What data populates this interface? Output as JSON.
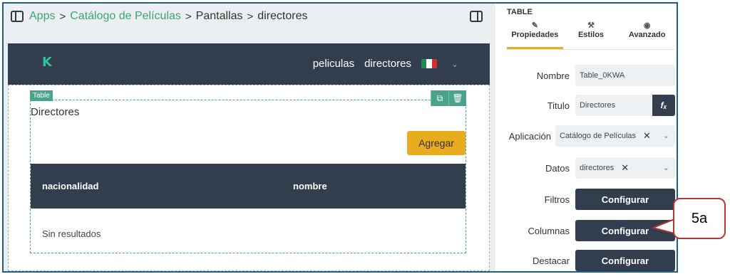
{
  "breadcrumb": {
    "items": [
      "Apps",
      "Catálogo de Películas",
      "Pantallas",
      "directores"
    ]
  },
  "navbar": {
    "logo": "K",
    "links": [
      "peliculas",
      "directores"
    ]
  },
  "table_component": {
    "tag": "Table",
    "title": "Directores",
    "add_label": "Agregar",
    "columns": [
      "nacionalidad",
      "nombre"
    ],
    "empty_text": "Sin resultados"
  },
  "panel": {
    "title": "TABLE",
    "tabs": [
      "Propiedades",
      "Estilos",
      "Avanzado"
    ],
    "fields": {
      "nombre_label": "Nombre",
      "nombre_value": "Table_0KWA",
      "titulo_label": "Titulo",
      "titulo_value": "Directores",
      "aplicacion_label": "Aplicación",
      "aplicacion_value": "Catálogo de Películas",
      "datos_label": "Datos",
      "datos_value": "directores",
      "filtros_label": "Filtros",
      "columnas_label": "Columnas",
      "destacar_label": "Destacar",
      "configurar_label": "Configurar"
    }
  },
  "callout": {
    "text": "5a"
  },
  "colors": {
    "accent_green": "#3aa47a",
    "dark": "#323e4d",
    "yellow": "#e8ac1e",
    "callout_border": "#b33333"
  },
  "icons": [
    "sidebar-toggle-icon",
    "panel-toggle-icon",
    "copy-icon",
    "trash-icon",
    "pencil-icon",
    "paint-bucket-icon",
    "eye-icon",
    "fx-icon",
    "close-icon",
    "chevron-down-icon",
    "mexico-flag-icon"
  ]
}
